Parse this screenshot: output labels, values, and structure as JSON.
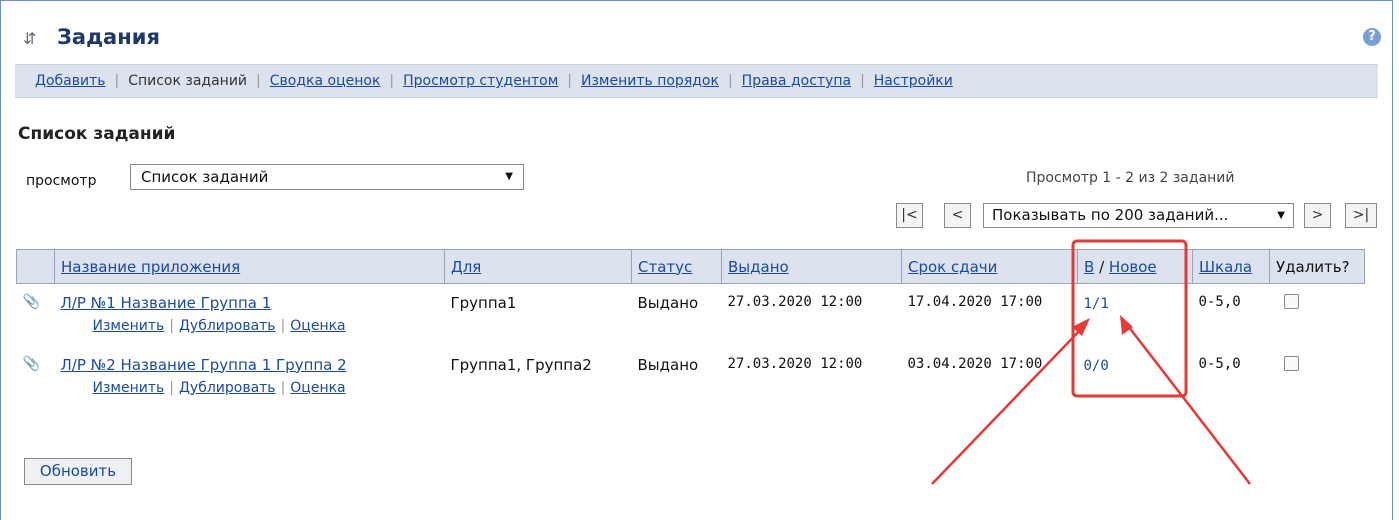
{
  "header": {
    "title": "Задания",
    "sync_icon": "sync-arrows-icon",
    "help_icon": "help-icon",
    "help_glyph": "?"
  },
  "toolbar": {
    "add": "Добавить",
    "list": "Список заданий",
    "grades": "Сводка оценок",
    "student_view": "Просмотр студентом",
    "reorder": "Изменить порядок",
    "access": "Права доступа",
    "settings": "Настройки"
  },
  "section_title": "Список заданий",
  "view": {
    "label": "просмотр",
    "selected": "Список заданий"
  },
  "paging": {
    "summary": "Просмотр 1 - 2 из 2 заданий",
    "first": "|<",
    "prev": "<",
    "per_page": "Показывать по 200 заданий...",
    "next": ">",
    "last": ">|"
  },
  "table": {
    "headers": {
      "name": "Название приложения",
      "for": "Для",
      "status": "Статус",
      "issued": "Выдано",
      "due": "Срок сдачи",
      "in": "В",
      "slash": "/",
      "new": "Новое",
      "scale": "Шкала",
      "delete": "Удалить?"
    },
    "rows": [
      {
        "name": "Л/Р №1 Название Группа 1",
        "for": "Группа1",
        "status": "Выдано",
        "issued": "27.03.2020 12:00",
        "due": "17.04.2020 17:00",
        "in_new": "1/1",
        "scale": "0-5,0",
        "actions": {
          "edit": "Изменить",
          "duplicate": "Дублировать",
          "grade": "Оценка"
        }
      },
      {
        "name": "Л/Р №2 Название Группа 1 Группа 2",
        "for": "Группа1, Группа2",
        "status": "Выдано",
        "issued": "27.03.2020 12:00",
        "due": "03.04.2020 17:00",
        "in_new": "0/0",
        "scale": "0-5,0",
        "actions": {
          "edit": "Изменить",
          "duplicate": "Дублировать",
          "grade": "Оценка"
        }
      }
    ]
  },
  "refresh_button": "Обновить",
  "colors": {
    "link": "#1a4aa6",
    "header_bg": "#dde3ee",
    "title": "#1b3a6a",
    "annotation": "#e53935"
  }
}
